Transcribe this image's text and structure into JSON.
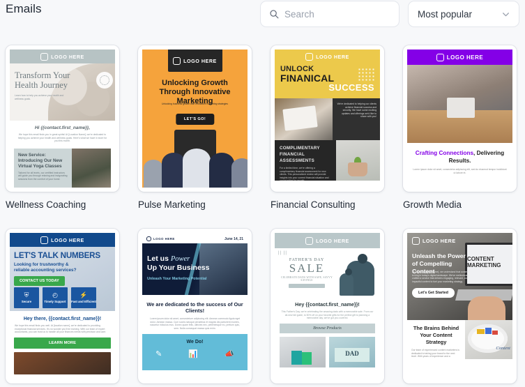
{
  "header": {
    "title": "Emails",
    "search": {
      "placeholder": "Search",
      "value": "",
      "icon": "search-icon"
    },
    "sort": {
      "value": "Most popular",
      "icon": "chevron-down-icon"
    }
  },
  "templates": [
    {
      "label": "Wellness Coaching",
      "logo": "LOGO HERE",
      "headline": "Transform Your Health Journey",
      "subhead": "Learn how to help you achieve your health and wellness goals.",
      "greeting": "Hi {{contact.first_name}},",
      "body": "We hope this email finds you in great spirits! At [Location Name], we're dedicated to helping you achieve your health and wellness goals. Here's what we have in store for you this month.",
      "promo_title": "New Service: Introducing Our New Virtual Yoga Classes",
      "promo_body": "Tailored for all levels, our certified instructors will guide you through relaxing and invigorating sessions from the comfort of your home."
    },
    {
      "label": "Pulse Marketing",
      "logo": "LOGO HERE",
      "headline": "Unlocking Growth Through Innovative Marketing",
      "subhead": "Unlocking business growth with innovative marketing strategies",
      "cta": "LET'S GO!"
    },
    {
      "label": "Financial Consulting",
      "logo": "LOGO HERE",
      "headline_1": "UNLOCK",
      "headline_2": "FINANICAL",
      "headline_3": "SUCCESS",
      "intro": "We're dedicated to helping our clients achieve financial success and security. We have some exciting updates and offerings we'd like to share with you!",
      "offer_title": "COMPLIMENTARY FINANCIAL ASSESSMENTS",
      "offer_body": "For a limited time, we're offering a complimentary financial assessment for new clients. This personalized review will provide insights into your current financial situation and opportunities for growth."
    },
    {
      "label": "Growth Media",
      "logo": "LOGO HERE",
      "headline_accent": "Crafting Connections",
      "headline_rest": ", Delivering Results.",
      "body": "Lorem ipsum dolor sit amet, consectetur adipiscing elit, sed do eiusmod tempor incididunt ut labore et."
    },
    {
      "label": "",
      "logo": "LOGO HERE",
      "headline": "LET'S TALK NUMBERS",
      "subhead": "Looking for trustworthy & reliable accounting services?",
      "cta": "CONTACT US TODAY",
      "features": [
        {
          "icon": "shield-icon",
          "glyph": "⛨",
          "caption": "Secure"
        },
        {
          "icon": "clock-icon",
          "glyph": "◴",
          "caption": "Timely Support"
        },
        {
          "icon": "bolt-icon",
          "glyph": "⚡",
          "caption": "Fast and Efficient"
        }
      ],
      "greeting": "Hey there, {{contact.first_name}}!",
      "body": "We hope this email finds you well. At [location name], we're dedicated to providing exceptional financial services. It's no wonder you'll be earning. With our team of expert accountants, you can trust us to handle all your finances needs with precision and care.",
      "learn_more": "LEARN MORE"
    },
    {
      "label": "",
      "logo": "LOGO HERE",
      "date": "June 14, 21",
      "headline_1": "Let us",
      "headline_script": "Power",
      "headline_2": "Up Your Business",
      "subhead": "Unleash Your Marketing Potential",
      "tagline": "We are dedicated to the success of Our Clients!",
      "body": "Lorem ipsum dolor sit amet, consectetuer adipiscing elit. Aenean commodo ligula eget dolor. Aenean massa. Cum sociis natoque penatibus et magnis dis parturient montes, nascetur ridiculus mus. Donec quam felis, ultricies nec, pellentesque eu, pretium quis, sem. Nulla consequat massa quis enim.",
      "section": "We Do!",
      "section_icons": [
        "edit-icon",
        "presentation-icon",
        "megaphone-icon"
      ]
    },
    {
      "label": "",
      "logo": "LOGO HERE",
      "eyebrow": "FATHER'S DAY",
      "headline": "SALE",
      "subhead": "CELEBRATE DADS WITH SAFE, SAVVY SAVINGS",
      "greeting": "Hey {{contact.first_name}}!",
      "body": "This Father's Day, we're celebrating the amazing dads with a memorable sale. From our all-new fall guide, to 50% off on your favorite gifts for the perfect gift to planning a memorable day, we've got you covered.",
      "browse": "Browse Products",
      "card_text": "Best Dad DAD"
    },
    {
      "label": "",
      "logo": "LOGO HERE",
      "headline": "Unleash the Power of Compelling Content",
      "body": "At [Your Company Name], we understand that content is king in today's digital landscape. We've meticulously crafted a service that delivers engaging, relevant, and impactful content to fuel your marketing strategy.",
      "cta": "Let's Get Started",
      "section_title": "The Brains Behind Your Content Strategy",
      "section_body": "Our team of experienced content marketers is dedicated to taking your brand to the next level. With years of experience and a",
      "screen_text": "CONTENT MARKETING",
      "ball_text": "Content"
    }
  ],
  "card_labels": [
    "Wellness Coaching",
    "Pulse Marketing",
    "Financial Consulting",
    "Growth Media"
  ]
}
